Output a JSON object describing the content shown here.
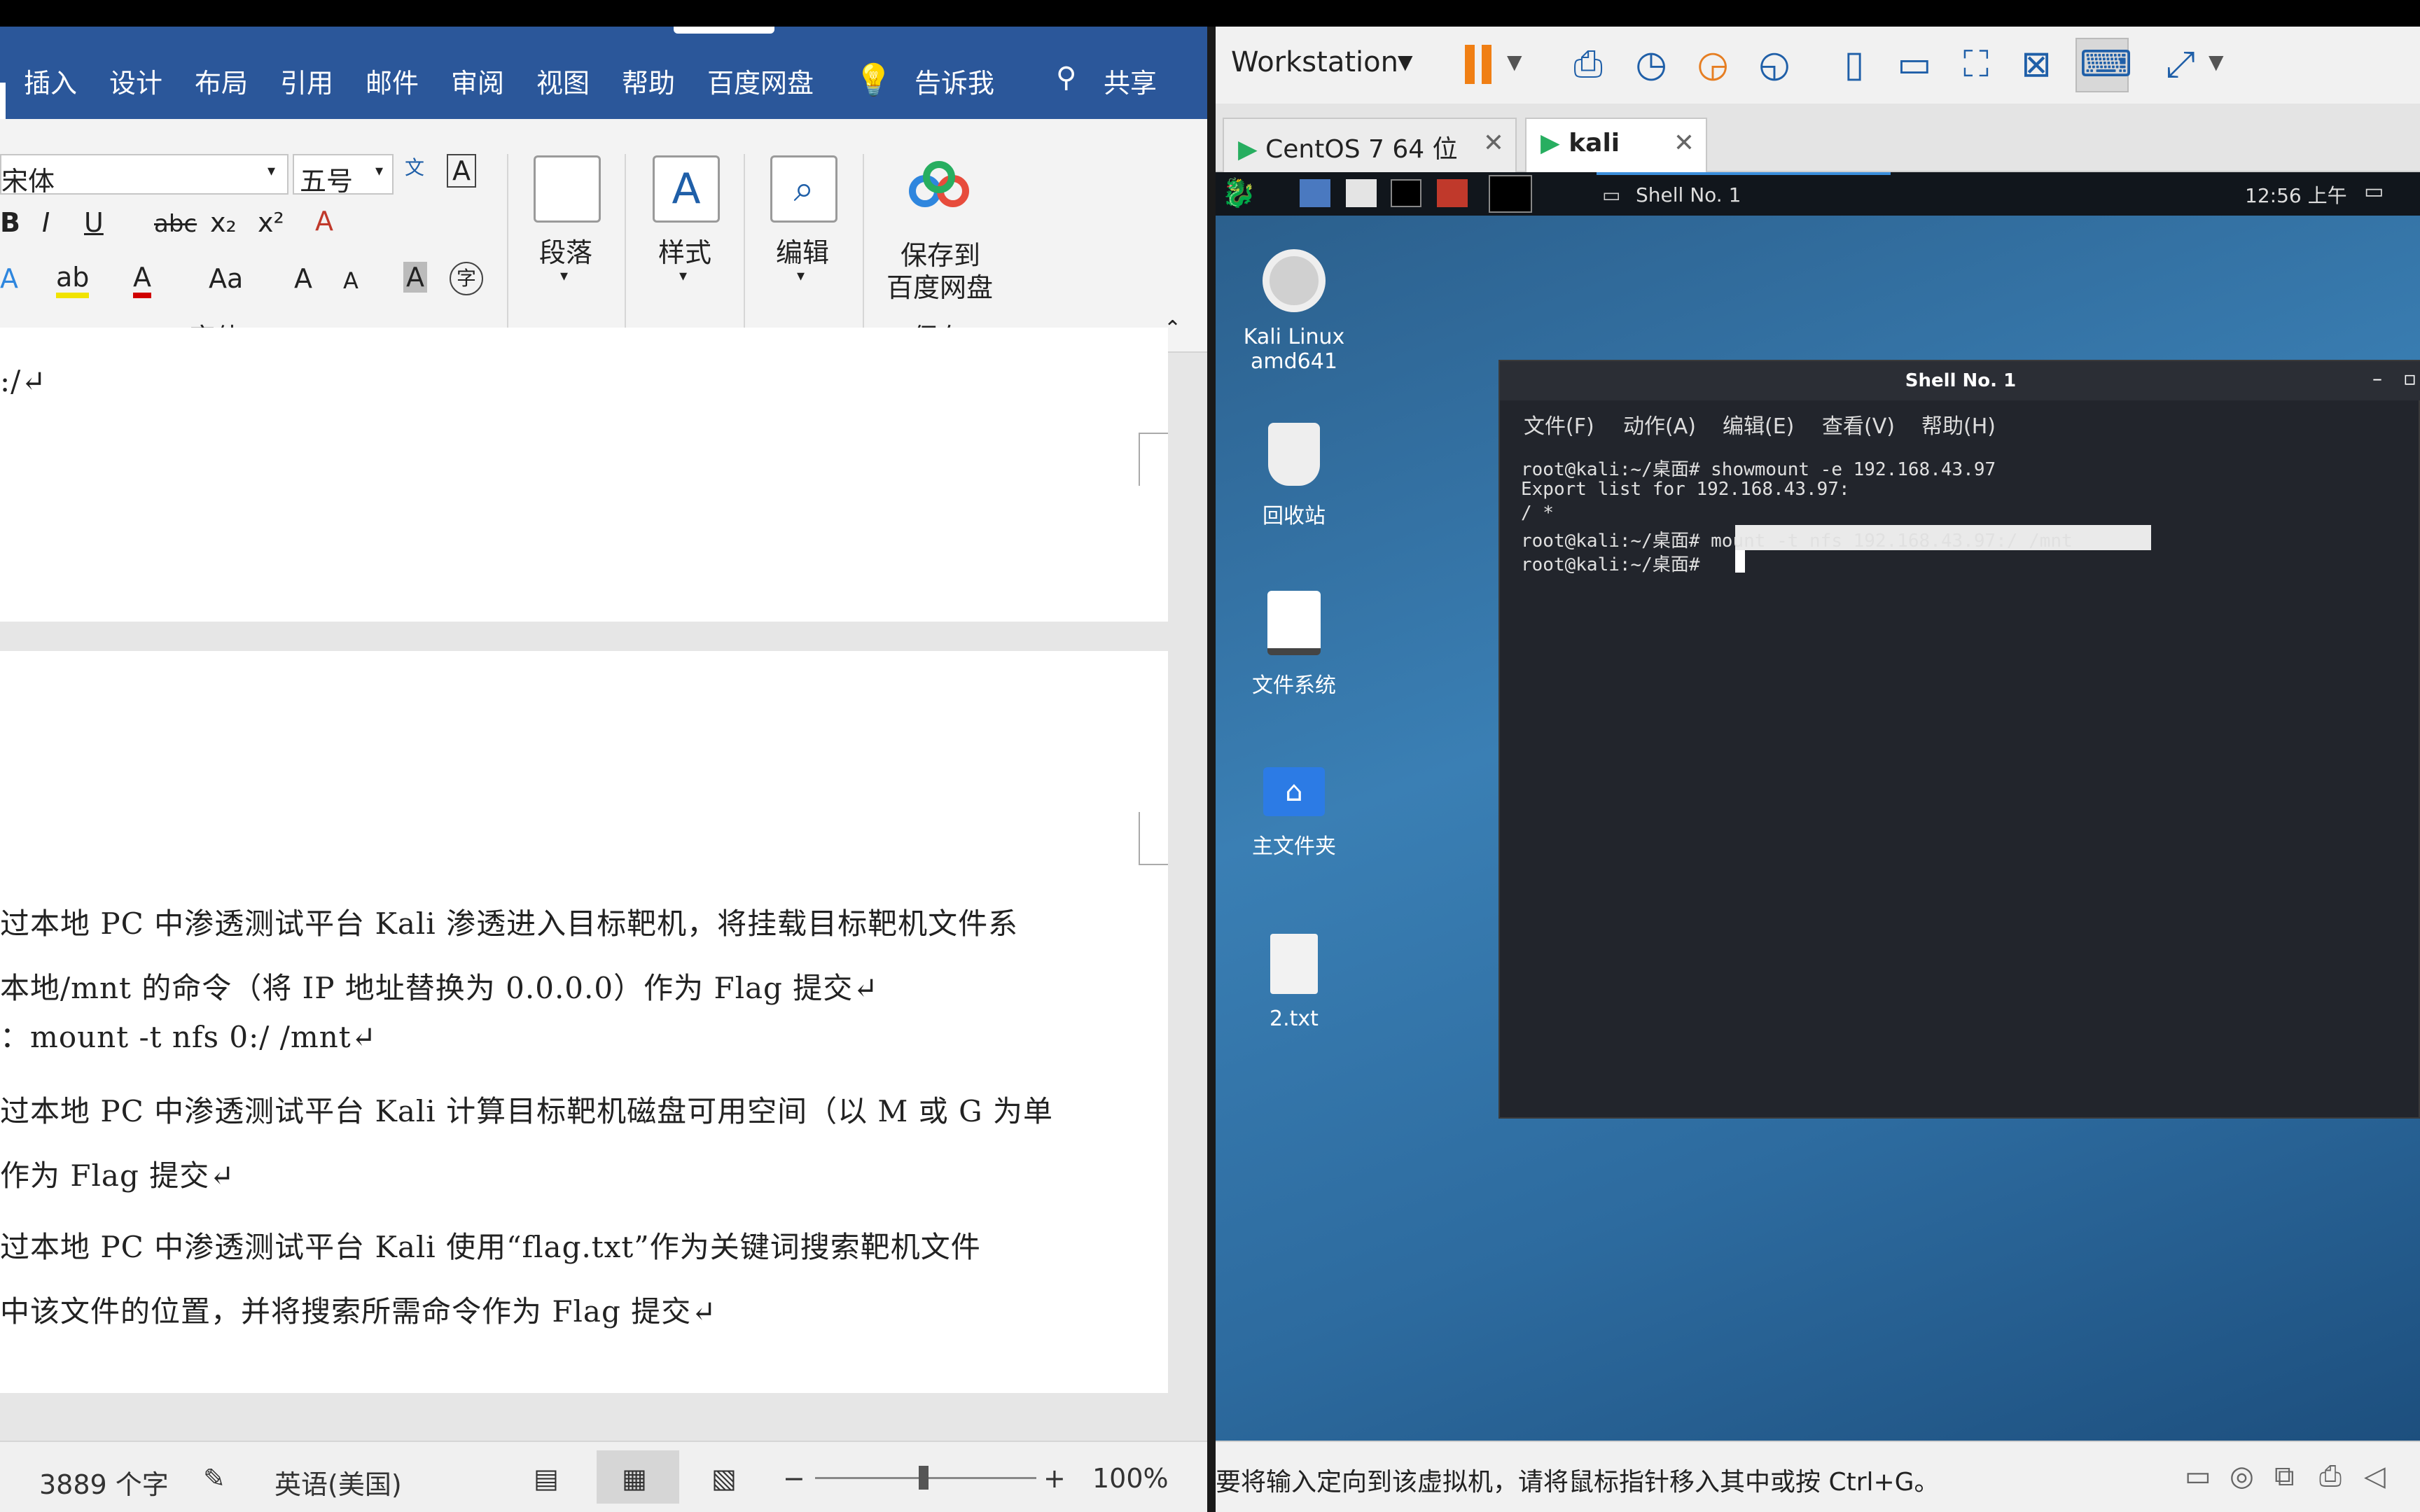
{
  "word": {
    "menu": [
      "插入",
      "设计",
      "布局",
      "引用",
      "邮件",
      "审阅",
      "视图",
      "帮助",
      "百度网盘"
    ],
    "tell_me": "告诉我",
    "share": "共享",
    "font_name": "宋体",
    "font_size": "五号",
    "group_font": "字体",
    "btn_paragraph": "段落",
    "btn_styles": "样式",
    "btn_edit": "编辑",
    "btn_save_baidu_1": "保存到",
    "btn_save_baidu_2": "百度网盘",
    "group_save": "保存",
    "page1_line": ":/↵",
    "lines": [
      "过本地 PC 中渗透测试平台 Kali 渗透进入目标靶机，将挂载目标靶机文件系",
      "本地/mnt 的命令（将 IP 地址替换为 0.0.0.0）作为 Flag 提交↵",
      "：mount -t nfs 0:/ /mnt↵",
      "过本地 PC 中渗透测试平台 Kali 计算目标靶机磁盘可用空间（以 M 或 G 为单",
      "作为 Flag 提交↵",
      "过本地 PC 中渗透测试平台 Kali 使用“flag.txt”作为关键词搜索靶机文件",
      "中该文件的位置，并将搜索所需命令作为 Flag 提交↵"
    ],
    "status": {
      "word_count": "3889 个字",
      "language": "英语(美国)",
      "zoom_minus": "−",
      "zoom_plus": "+",
      "zoom": "100%"
    }
  },
  "vmware": {
    "app_name": "Workstation",
    "tabs": [
      {
        "label": "CentOS 7 64 位"
      },
      {
        "label": "kali"
      }
    ],
    "guest": {
      "task_title": "Shell No. 1",
      "clock": "12:56 上午",
      "desktop_icons": [
        {
          "label_1": "Kali Linux",
          "label_2": "amd641"
        },
        {
          "label_1": "回收站"
        },
        {
          "label_1": "文件系统"
        },
        {
          "label_1": "主文件夹"
        },
        {
          "label_1": "2.txt"
        }
      ],
      "terminal": {
        "title": "Shell No. 1",
        "menu": [
          "文件(F)",
          "动作(A)",
          "编辑(E)",
          "查看(V)",
          "帮助(H)"
        ],
        "lines": [
          "root@kali:~/桌面# showmount -e 192.168.43.97",
          "Export list for 192.168.43.97:",
          "/ *",
          "root@kali:~/桌面# mount -t nfs 192.168.43.97:/ /mnt",
          "root@kali:~/桌面# "
        ]
      }
    },
    "status_hint": "要将输入定向到该虚拟机，请将鼠标指针移入其中或按 Ctrl+G。"
  }
}
